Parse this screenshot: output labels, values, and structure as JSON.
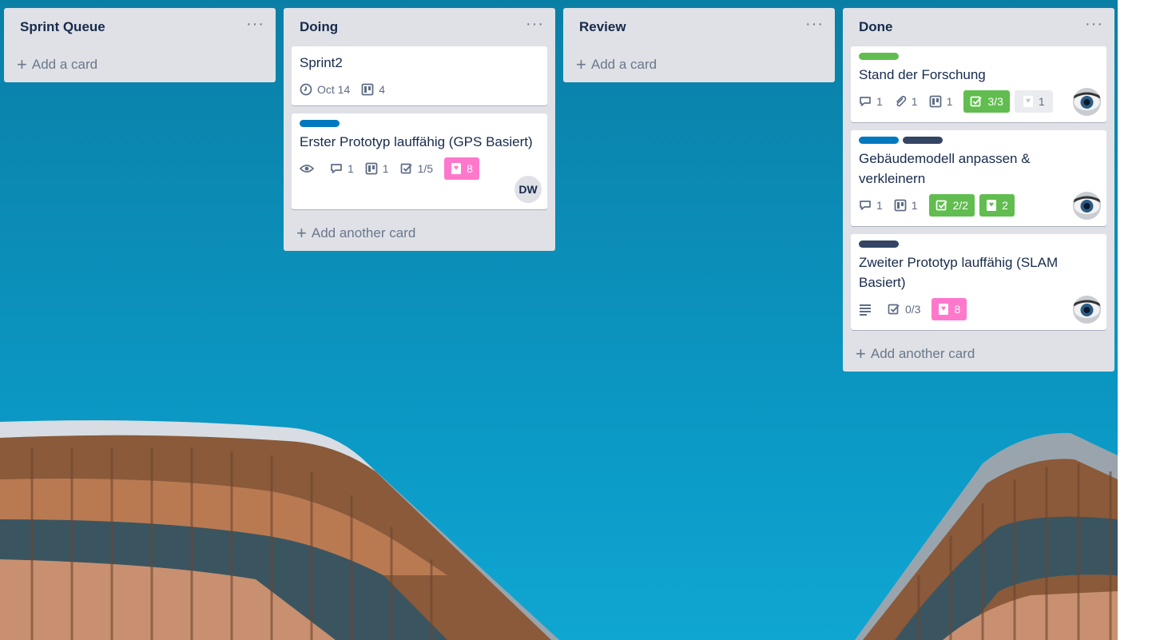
{
  "lists": [
    {
      "title": "Sprint Queue",
      "add_label": "Add a card"
    },
    {
      "title": "Doing",
      "add_label": "Add another card",
      "cards": [
        {
          "title": "Sprint2",
          "due": "Oct 14",
          "board_count": "4"
        },
        {
          "title": "Erster Prototyp lauffähig (GPS Basiert)",
          "comments": "1",
          "board_count": "1",
          "checklist": "1/5",
          "points": "8",
          "member_initials": "DW",
          "label_colors": [
            "#0079bf"
          ]
        }
      ]
    },
    {
      "title": "Review",
      "add_label": "Add a card"
    },
    {
      "title": "Done",
      "add_label": "Add another card",
      "cards": [
        {
          "title": "Stand der Forschung",
          "comments": "1",
          "attachments": "1",
          "board_count": "1",
          "checklist": "3/3",
          "points": "1",
          "label_colors": [
            "#61bd4f"
          ]
        },
        {
          "title": "Gebäudemodell anpassen & verkleinern",
          "comments": "1",
          "board_count": "1",
          "checklist": "2/2",
          "points": "2",
          "label_colors": [
            "#0079bf",
            "#344563"
          ]
        },
        {
          "title": "Zweiter Prototyp lauffähig (SLAM Basiert)",
          "checklist": "0/3",
          "points": "8",
          "label_colors": [
            "#344563"
          ]
        }
      ]
    }
  ],
  "list_menu_glyph": "···",
  "add_plus_glyph": "+",
  "colors": {
    "board_bg": "#0b8cb6",
    "list_bg": "#dfe1e6",
    "green": "#61bd4f",
    "blue": "#0079bf",
    "dark": "#344563",
    "pink": "#ff78cb"
  }
}
